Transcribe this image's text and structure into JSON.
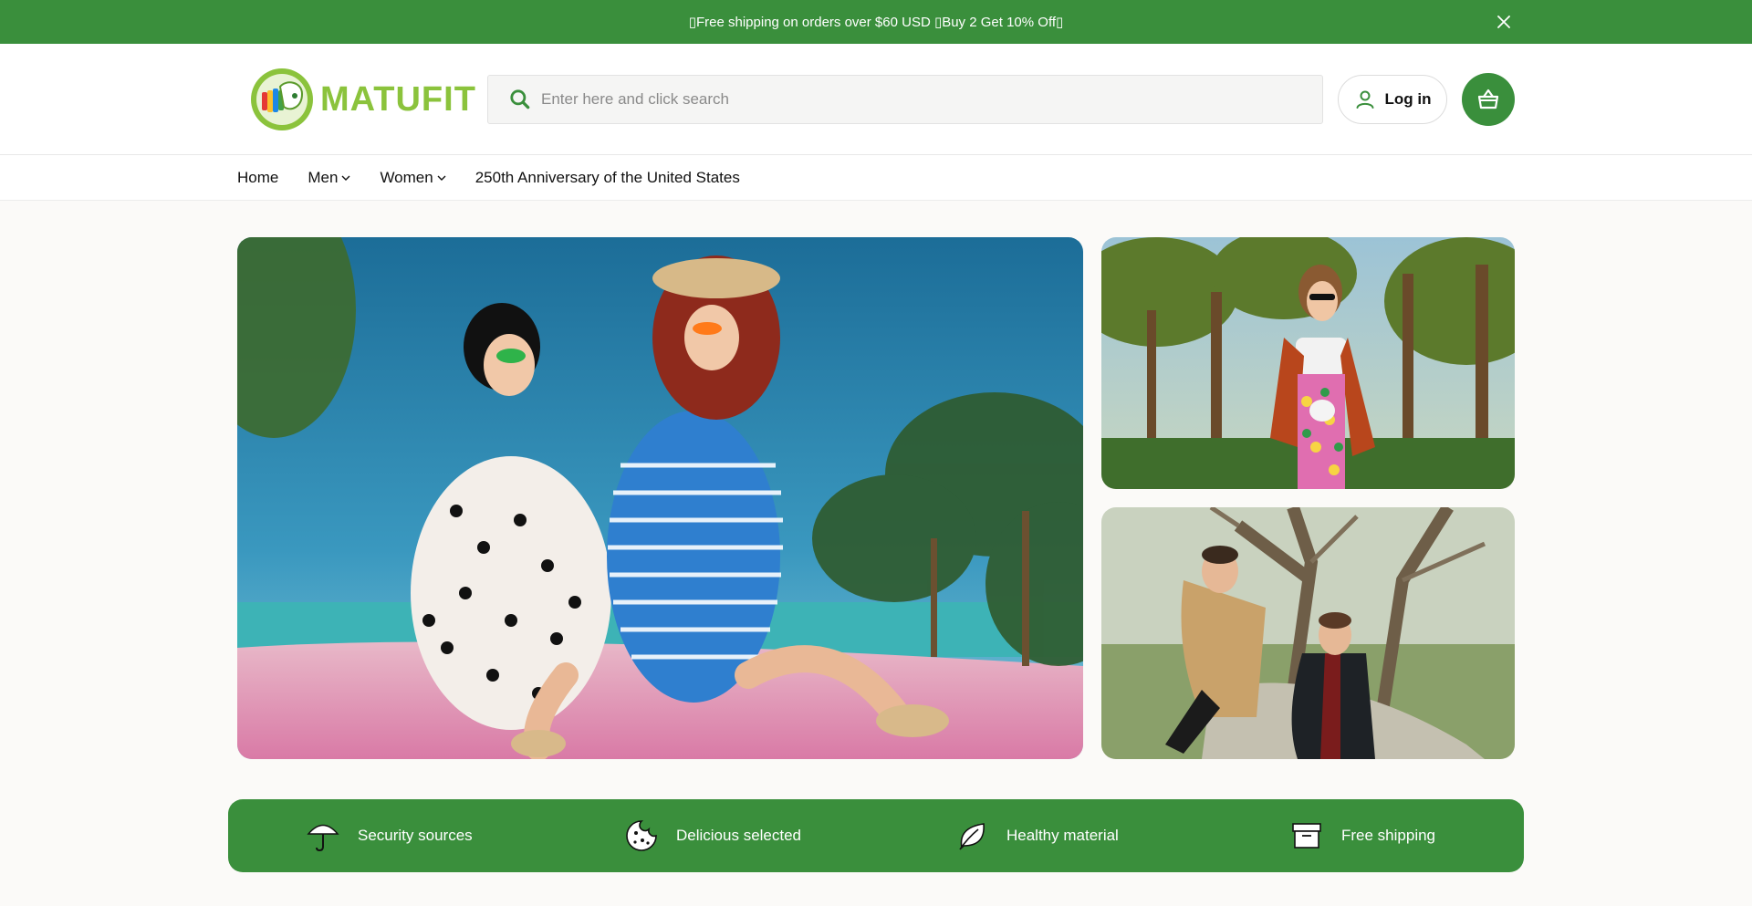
{
  "announcement": {
    "text": "▯Free shipping on orders over $60 USD ▯Buy 2 Get 10% Off▯",
    "close_icon": "close-icon"
  },
  "header": {
    "logo_text": "MATUFIT",
    "search": {
      "placeholder": "Enter here and click search",
      "value": ""
    },
    "login_label": "Log in",
    "cart_icon": "basket-icon"
  },
  "nav": {
    "items": [
      {
        "label": "Home",
        "has_dropdown": false
      },
      {
        "label": "Men",
        "has_dropdown": true
      },
      {
        "label": "Women",
        "has_dropdown": true
      },
      {
        "label": "250th Anniversary of the United States",
        "has_dropdown": false
      }
    ]
  },
  "hero": {
    "main_image": "beach-fashion-photo",
    "side_image_1": "palm-woman-photo",
    "side_image_2": "men-outdoor-photo"
  },
  "features": [
    {
      "label": "Security sources",
      "icon": "umbrella-icon"
    },
    {
      "label": "Delicious selected",
      "icon": "cookie-icon"
    },
    {
      "label": "Healthy material",
      "icon": "leaf-icon"
    },
    {
      "label": "Free shipping",
      "icon": "box-icon"
    }
  ],
  "colors": {
    "brand_green": "#3a8f3c",
    "logo_green": "#8bc33c"
  }
}
